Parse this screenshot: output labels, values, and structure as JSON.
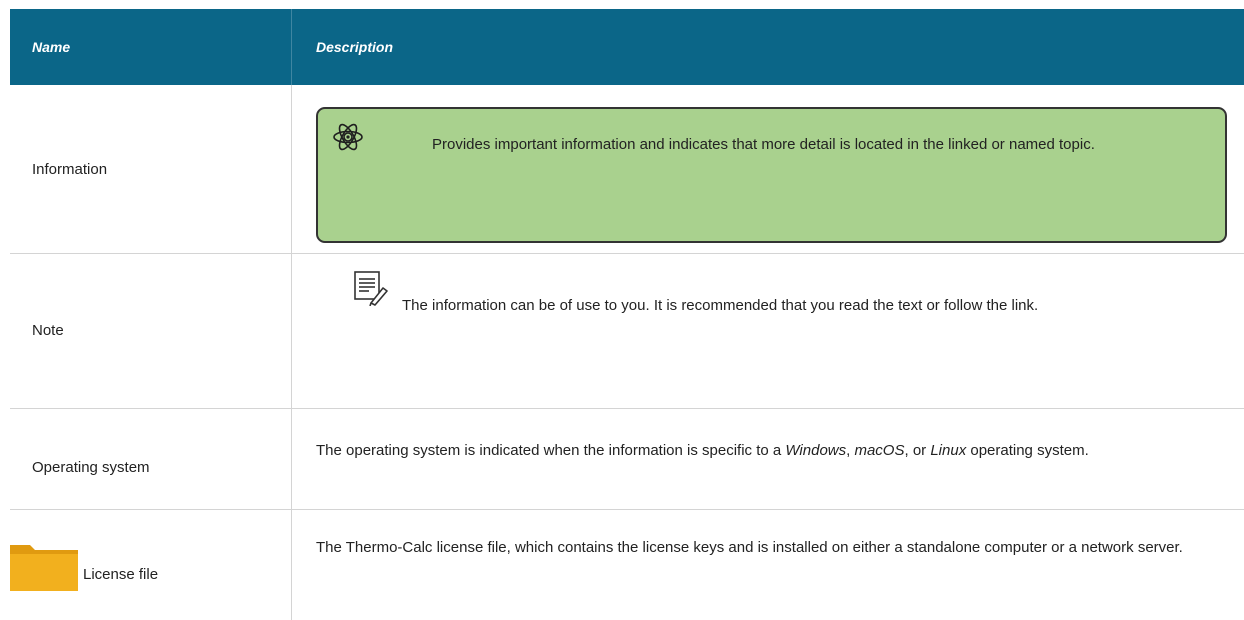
{
  "header": {
    "name_label": "Name",
    "description_label": "Description"
  },
  "rows": [
    {
      "name": "Information",
      "description": "Provides important information and indicates that more detail is located in the linked or named topic.",
      "icon": "atom-information-icon",
      "callout_color": "#a9d18e"
    },
    {
      "name": "Note",
      "description": "The information can be of use to you. It is recommended that you read the text or follow the link.",
      "icon": "note-pencil-icon"
    },
    {
      "name": "Operating system",
      "description_parts": {
        "p1": "The operating system is indicated when the information is specific to a ",
        "windows": "Windows",
        "sep1": ", ",
        "macos": "macOS",
        "sep2": ", or ",
        "linux": "Linux",
        "p2": " operating system."
      }
    },
    {
      "name": "License file",
      "description": "The Thermo-Calc license file, which contains the license keys and is installed on either a standalone computer or a network server.",
      "icon": "folder-icon"
    }
  ],
  "colors": {
    "header_bg": "#0b6688",
    "callout_bg": "#a9d18e",
    "folder": "#f2b01e"
  }
}
